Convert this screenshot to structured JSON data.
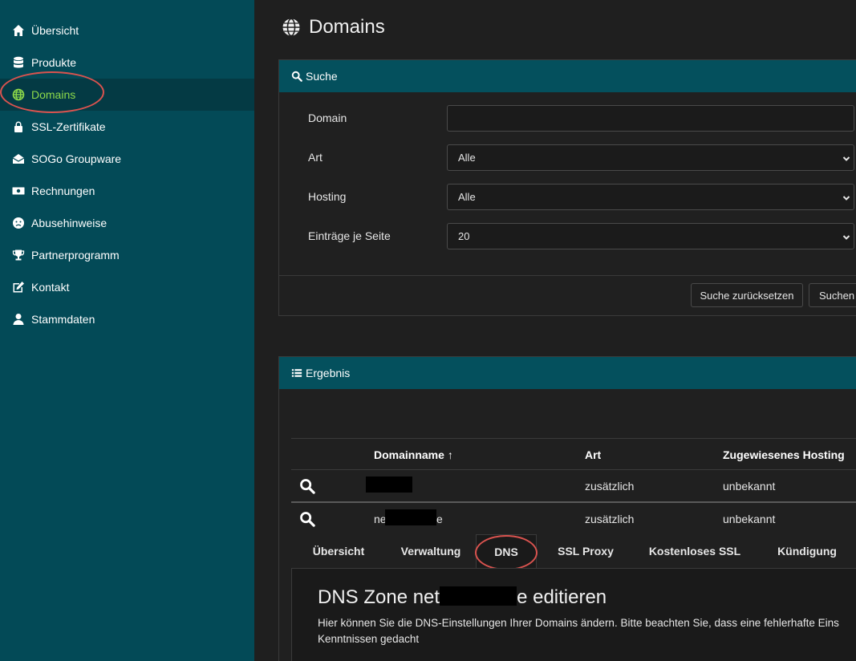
{
  "sidebar": {
    "items": [
      {
        "label": "Übersicht",
        "icon": "home-icon"
      },
      {
        "label": "Produkte",
        "icon": "database-icon"
      },
      {
        "label": "Domains",
        "icon": "globe-icon",
        "active": true
      },
      {
        "label": "SSL-Zertifikate",
        "icon": "lock-icon"
      },
      {
        "label": "SOGo Groupware",
        "icon": "envelope-open-icon"
      },
      {
        "label": "Rechnungen",
        "icon": "money-bill-icon"
      },
      {
        "label": "Abusehinweise",
        "icon": "frown-icon"
      },
      {
        "label": "Partnerprogramm",
        "icon": "trophy-icon"
      },
      {
        "label": "Kontakt",
        "icon": "edit-icon"
      },
      {
        "label": "Stammdaten",
        "icon": "user-icon"
      }
    ]
  },
  "page": {
    "title": "Domains"
  },
  "search": {
    "header": "Suche",
    "fields": {
      "domain_label": "Domain",
      "domain_value": "",
      "art_label": "Art",
      "art_value": "Alle",
      "hosting_label": "Hosting",
      "hosting_value": "Alle",
      "per_page_label": "Einträge je Seite",
      "per_page_value": "20"
    },
    "reset_label": "Suche zurücksetzen",
    "submit_label": "Suchen"
  },
  "results": {
    "header": "Ergebnis",
    "columns": [
      "Domainname",
      "Art",
      "Zugewiesenes Hosting"
    ],
    "sort_indicator": "↑",
    "rows": [
      {
        "domain": "",
        "art": "zusätzlich",
        "hosting": "unbekannt"
      },
      {
        "domain_prefix": "ne",
        "domain_suffix": "e",
        "art": "zusätzlich",
        "hosting": "unbekannt"
      }
    ]
  },
  "detail_tabs": [
    "Übersicht",
    "Verwaltung",
    "DNS",
    "SSL Proxy",
    "Kostenloses SSL",
    "Kündigung"
  ],
  "active_tab": "DNS",
  "dns": {
    "title_prefix": "DNS Zone net",
    "title_suffix": "e editieren",
    "description_line1": "Hier können Sie die DNS-Einstellungen Ihrer Domains ändern. Bitte beachten Sie, dass eine fehlerhafte Eins",
    "description_line2": "Kenntnissen gedacht"
  },
  "colors": {
    "sidebar_bg": "#034a57",
    "active_item_bg": "#043a44",
    "active_item_text": "#8dd94a",
    "panel_header_bg": "#04505d",
    "highlight_ring": "#d9534f"
  }
}
